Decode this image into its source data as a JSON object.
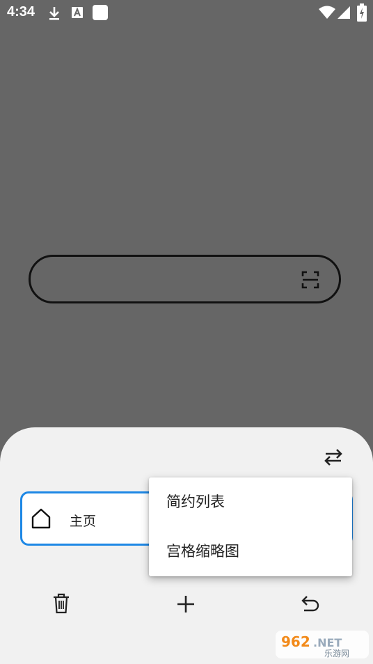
{
  "status_bar": {
    "time": "4:34",
    "icons": [
      "download-icon",
      "a-badge-icon",
      "app-square-icon",
      "wifi-icon",
      "signal-icon",
      "battery-icon"
    ]
  },
  "search": {
    "placeholder": "",
    "scan_icon": "scan-icon"
  },
  "sheet": {
    "switch_icon": "swap-arrows-icon",
    "tabs": [
      {
        "icon": "home-icon",
        "title": "主页"
      }
    ],
    "menu": {
      "items": [
        {
          "label": "简约列表"
        },
        {
          "label": "宫格缩略图"
        }
      ]
    },
    "toolbar": {
      "icons": [
        "trash-icon",
        "add-icon",
        "undo-icon"
      ]
    }
  },
  "watermark": {
    "brand": "962.NET",
    "subtitle": "乐游网"
  },
  "colors": {
    "background": "#666666",
    "sheet": "#f1f1f1",
    "accent": "#1e88e5"
  }
}
